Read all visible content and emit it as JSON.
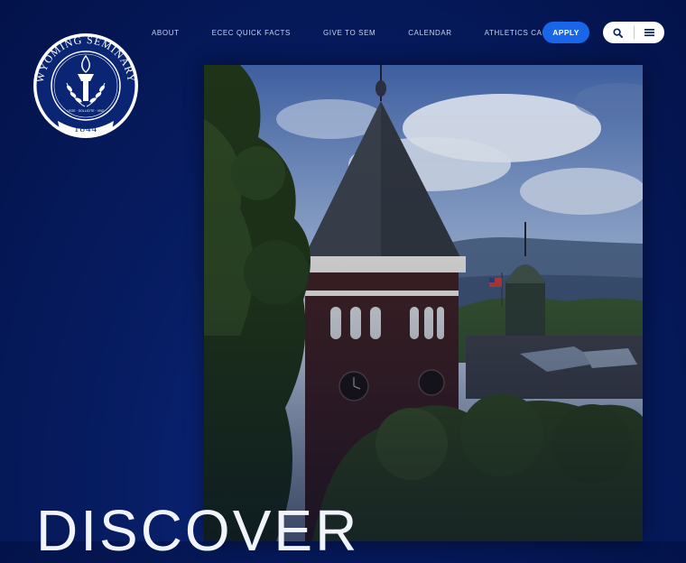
{
  "logo": {
    "name_text": "WYOMING SEMINARY",
    "year": "1844",
    "motto": "LEGE · SOLLICITE · VIVE",
    "alt": "Wyoming Seminary seal"
  },
  "nav": {
    "items": [
      {
        "label": "ABOUT"
      },
      {
        "label": "ECEC QUICK FACTS"
      },
      {
        "label": "GIVE TO SEM"
      },
      {
        "label": "CALENDAR"
      },
      {
        "label": "ATHLETICS CALENDAR"
      }
    ],
    "apply_label": "APPLY"
  },
  "utility": {
    "search_icon": "search-icon",
    "menu_icon": "hamburger-menu-icon"
  },
  "hero": {
    "image": "campus-clock-tower-photo",
    "heading": "DISCOVER"
  },
  "colors": {
    "background": "#071d63",
    "apply_button": "#1a66e8",
    "utility_pill": "#ffffff"
  }
}
